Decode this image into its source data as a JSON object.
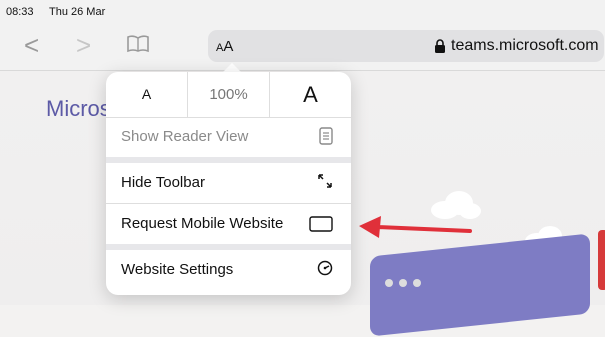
{
  "status": {
    "time": "08:33",
    "date": "Thu 26 Mar"
  },
  "toolbar": {
    "back_glyph": "<",
    "forward_glyph": ">",
    "reader_icon": "book-icon",
    "text_size_button": {
      "small": "A",
      "large": "A"
    },
    "url": "teams.microsoft.com",
    "lock_icon": "lock-icon"
  },
  "page": {
    "title_fragment": "Micros"
  },
  "popover": {
    "font_smaller": "A",
    "zoom": "100%",
    "font_larger": "A",
    "items": [
      {
        "label": "Show Reader View",
        "icon": "reader-view-icon",
        "enabled": false
      },
      {
        "label": "Hide Toolbar",
        "icon": "expand-arrows-icon",
        "enabled": true
      },
      {
        "label": "Request Mobile Website",
        "icon": "mobile-frame-icon",
        "enabled": true
      },
      {
        "label": "Website Settings",
        "icon": "settings-gauge-icon",
        "enabled": true
      }
    ]
  },
  "annotation": {
    "arrow_color": "#e0303a"
  },
  "colors": {
    "brand_purple": "#5c5aa6",
    "card_purple": "#7e7cc4"
  }
}
